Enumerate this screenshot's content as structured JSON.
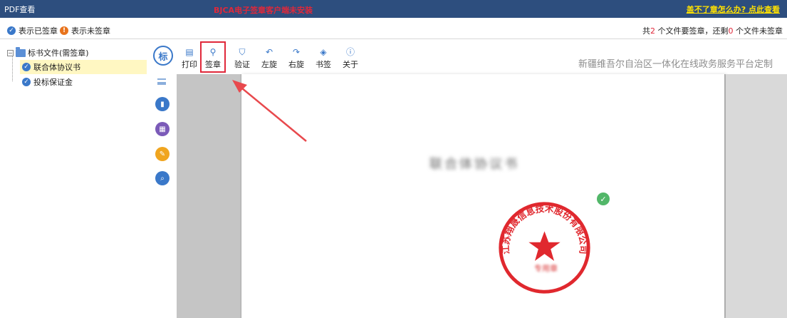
{
  "titlebar": {
    "app_title": "PDF查看",
    "warning": "BJCA电子签章客户端未安装",
    "help_link": "盖不了章怎么办? 点此查看"
  },
  "legend": {
    "signed": "表示已签章",
    "unsigned": "表示未签章",
    "summary_prefix": "共",
    "total": "2",
    "summary_mid": " 个文件要签章，还剩",
    "remaining": "0",
    "summary_suffix": " 个文件未签章"
  },
  "tree": {
    "root_label": "标书文件(需签章)",
    "items": [
      {
        "label": "联合体协议书",
        "selected": true
      },
      {
        "label": "投标保证金",
        "selected": false
      }
    ]
  },
  "sidebar": {
    "logo_text": "标",
    "buttons": [
      {
        "icon": "document-icon",
        "glyph": "▮",
        "color": "#3a78c9"
      },
      {
        "icon": "grid-icon",
        "glyph": "▦",
        "color": "#7b5ab8"
      },
      {
        "icon": "pen-icon",
        "glyph": "✎",
        "color": "#f0a51f"
      },
      {
        "icon": "search-icon",
        "glyph": "⌕",
        "color": "#3a78c9"
      }
    ]
  },
  "toolbar": {
    "tools": [
      {
        "label": "打印",
        "icon": "printer-icon",
        "glyph": "▤"
      },
      {
        "label": "签章",
        "icon": "user-stamp-icon",
        "glyph": "⚲"
      },
      {
        "label": "验证",
        "icon": "shield-icon",
        "glyph": "⛉"
      },
      {
        "label": "左旋",
        "icon": "rotate-left-icon",
        "glyph": "↶"
      },
      {
        "label": "右旋",
        "icon": "rotate-right-icon",
        "glyph": "↷"
      },
      {
        "label": "书签",
        "icon": "bookmark-tag-icon",
        "glyph": "◈"
      },
      {
        "label": "关于",
        "icon": "info-icon",
        "glyph": "ⓘ"
      }
    ],
    "platform_name": "新疆维吾尔自治区一体化在线政务服务平台定制"
  },
  "document": {
    "title": "联合体协议书",
    "seal_text": "江苏翔晟信息技术股份有限公司",
    "seal_sub": "专用章"
  },
  "colors": {
    "titlebar": "#2d4e7e",
    "accent": "#3a78c9",
    "alert": "#e0283a",
    "link": "#ffe100",
    "selected": "#fff7c2"
  }
}
